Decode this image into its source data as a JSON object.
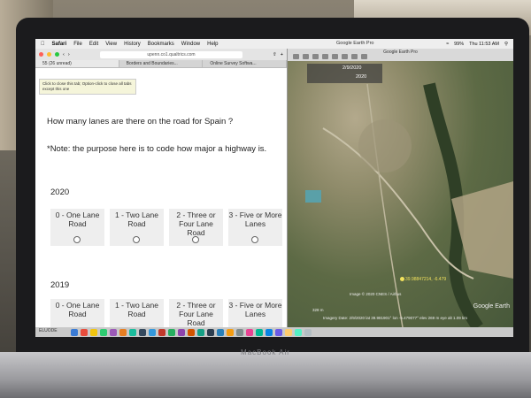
{
  "system_menu": {
    "items": [
      "Safari",
      "File",
      "Edit",
      "View",
      "History",
      "Bookmarks",
      "Window",
      "Help"
    ],
    "right_title": "Google Earth Pro",
    "battery": "99%",
    "clock": "Thu 11:53 AM"
  },
  "safari": {
    "url": "upenn.co1.qualtrics.com",
    "tabs": [
      "55 (26 unread)",
      "Borders and Boundaries...",
      "Online Survey Softwa..."
    ],
    "tooltip": "Click to close this tab; Option-click to close all tabs except this one"
  },
  "survey": {
    "question": "How many lanes are there on the road for Spain ?",
    "note": "*Note: the purpose here is to code how major a highway is.",
    "blocks": [
      {
        "year": "2020",
        "options": [
          "0 - One Lane Road",
          "1 - Two Lane Road",
          "2 - Three or Four Lane Road",
          "3 - Five or More Lanes"
        ]
      },
      {
        "year": "2019",
        "options": [
          "0 - One Lane Road",
          "1 - Two Lane Road",
          "2 - Three or Four Lane Road",
          "3 - Five or More Lanes"
        ]
      }
    ]
  },
  "earth": {
    "window_title": "Google Earth Pro",
    "time_top": "2/9/2020",
    "time_bottom": "2020",
    "pin_coord": "39.98847214, -6.479",
    "copyright": "Image © 2020 CNES / Airbus",
    "status": "Imagery Date: 2/9/2020    lat 39.981901°  lon -6.479077°  elev 269 m   eye alt 1.09 km",
    "scale": "328 m",
    "logo": "Google Earth"
  },
  "dock": {
    "left_label": "ELUODE"
  },
  "laptop": {
    "brand": "MacBook Air"
  }
}
